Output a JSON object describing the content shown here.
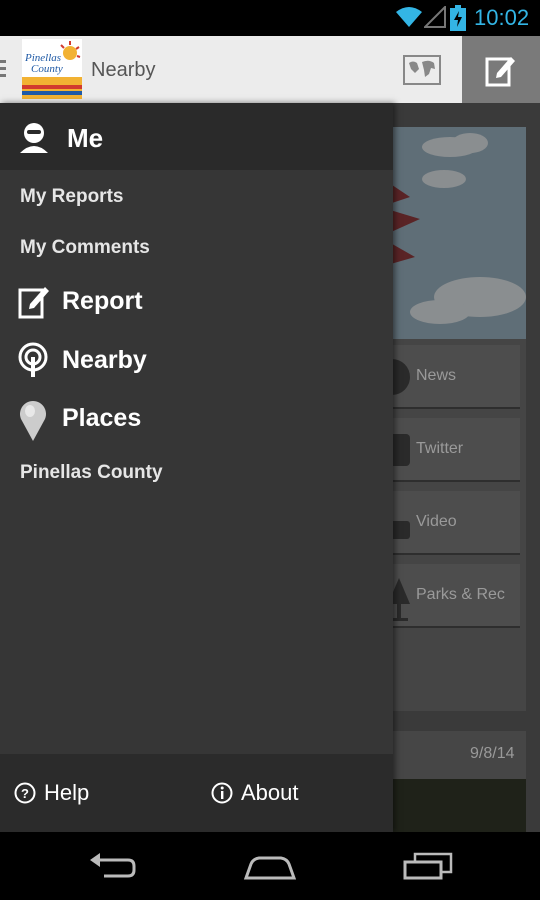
{
  "status_bar": {
    "time": "10:02",
    "icons": [
      "wifi-icon",
      "signal-icon",
      "battery-charging-icon"
    ],
    "accent_color": "#33b5e5"
  },
  "action_bar": {
    "title": "Nearby",
    "logo_text_line1": "Pinellas",
    "logo_text_line2": "County",
    "actions": [
      "map-icon",
      "edit-icon"
    ]
  },
  "drawer": {
    "header": {
      "label": "Me",
      "icon": "person-icon"
    },
    "sub_items": [
      "My Reports",
      "My Comments"
    ],
    "main_items": [
      {
        "label": "Report",
        "icon": "edit-icon"
      },
      {
        "label": "Nearby",
        "icon": "nearby-icon"
      },
      {
        "label": "Places",
        "icon": "pin-icon"
      }
    ],
    "county_label": "Pinellas County",
    "footer": {
      "help_label": "Help",
      "about_label": "About"
    }
  },
  "background": {
    "tiles": [
      "News",
      "Twitter",
      "Video",
      "Parks & Rec"
    ],
    "news_date": "9/8/14"
  },
  "nav_bar": {
    "buttons": [
      "back-icon",
      "home-icon",
      "recent-apps-icon"
    ]
  }
}
